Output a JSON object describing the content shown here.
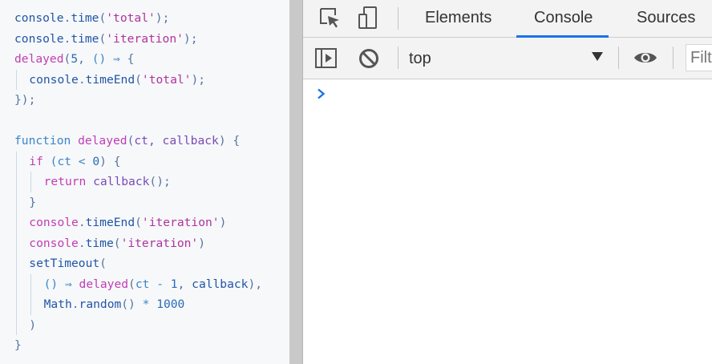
{
  "code": {
    "lines": [
      [
        {
          "t": "console",
          "c": "fn"
        },
        {
          "t": ".",
          "c": "punc"
        },
        {
          "t": "time",
          "c": "fn"
        },
        {
          "t": "(",
          "c": "punc"
        },
        {
          "t": "'total'",
          "c": "str"
        },
        {
          "t": ");",
          "c": "punc"
        }
      ],
      [
        {
          "t": "console",
          "c": "fn"
        },
        {
          "t": ".",
          "c": "punc"
        },
        {
          "t": "time",
          "c": "fn"
        },
        {
          "t": "(",
          "c": "punc"
        },
        {
          "t": "'iteration'",
          "c": "str"
        },
        {
          "t": ");",
          "c": "punc"
        }
      ],
      [
        {
          "t": "delayed",
          "c": "kw"
        },
        {
          "t": "(",
          "c": "punc"
        },
        {
          "t": "5",
          "c": "num"
        },
        {
          "t": ", ",
          "c": "punc"
        },
        {
          "t": "() ⇒ ",
          "c": "op"
        },
        {
          "t": "{",
          "c": "punc"
        }
      ],
      [
        {
          "t": "console",
          "c": "fn"
        },
        {
          "t": ".",
          "c": "punc"
        },
        {
          "t": "timeEnd",
          "c": "fn"
        },
        {
          "t": "(",
          "c": "punc"
        },
        {
          "t": "'total'",
          "c": "str"
        },
        {
          "t": ");",
          "c": "punc"
        }
      ],
      [
        {
          "t": "});",
          "c": "punc"
        }
      ],
      [],
      [
        {
          "t": "function ",
          "c": "op"
        },
        {
          "t": "delayed",
          "c": "kw"
        },
        {
          "t": "(",
          "c": "punc"
        },
        {
          "t": "ct, callback",
          "c": "ident"
        },
        {
          "t": ") {",
          "c": "punc"
        }
      ],
      [
        {
          "t": "if ",
          "c": "kw"
        },
        {
          "t": "(ct < ",
          "c": "op"
        },
        {
          "t": "0",
          "c": "num"
        },
        {
          "t": ") {",
          "c": "punc"
        }
      ],
      [
        {
          "t": "return ",
          "c": "kw"
        },
        {
          "t": "callback",
          "c": "ident"
        },
        {
          "t": "();",
          "c": "punc"
        }
      ],
      [
        {
          "t": "}",
          "c": "punc"
        }
      ],
      [
        {
          "t": "console",
          "c": "kw"
        },
        {
          "t": ".",
          "c": "punc"
        },
        {
          "t": "timeEnd",
          "c": "fn"
        },
        {
          "t": "(",
          "c": "punc"
        },
        {
          "t": "'iteration'",
          "c": "str"
        },
        {
          "t": ")",
          "c": "punc"
        }
      ],
      [
        {
          "t": "console",
          "c": "kw"
        },
        {
          "t": ".",
          "c": "punc"
        },
        {
          "t": "time",
          "c": "fn"
        },
        {
          "t": "(",
          "c": "punc"
        },
        {
          "t": "'iteration'",
          "c": "str"
        },
        {
          "t": ")",
          "c": "punc"
        }
      ],
      [
        {
          "t": "setTimeout",
          "c": "fn"
        },
        {
          "t": "(",
          "c": "punc"
        }
      ],
      [
        {
          "t": "() ⇒ ",
          "c": "op"
        },
        {
          "t": "delayed",
          "c": "kw"
        },
        {
          "t": "(",
          "c": "punc"
        },
        {
          "t": "ct - ",
          "c": "op"
        },
        {
          "t": "1",
          "c": "num"
        },
        {
          "t": ", ",
          "c": "punc"
        },
        {
          "t": "callback",
          "c": "fn"
        },
        {
          "t": "),",
          "c": "punc"
        }
      ],
      [
        {
          "t": "Math",
          "c": "fn"
        },
        {
          "t": ".",
          "c": "punc"
        },
        {
          "t": "random",
          "c": "fn"
        },
        {
          "t": "() ",
          "c": "punc"
        },
        {
          "t": "* ",
          "c": "op"
        },
        {
          "t": "1000",
          "c": "num"
        }
      ],
      [
        {
          "t": ")",
          "c": "punc"
        }
      ],
      [
        {
          "t": "}",
          "c": "punc"
        }
      ]
    ],
    "indents": [
      0,
      0,
      0,
      1,
      0,
      0,
      0,
      1,
      2,
      1,
      1,
      1,
      1,
      2,
      2,
      1,
      0
    ]
  },
  "devtools": {
    "tabs": [
      {
        "label": "Elements",
        "active": false
      },
      {
        "label": "Console",
        "active": true
      },
      {
        "label": "Sources",
        "active": false
      }
    ],
    "context_value": "top",
    "filter_placeholder": "Filter",
    "accent_color": "#1a73e8",
    "icons": {
      "inspect": "inspect-element-icon",
      "device": "device-toolbar-icon",
      "sidebar": "console-sidebar-icon",
      "clear": "clear-console-icon",
      "eye": "live-expression-eye-icon",
      "prompt": "console-prompt-chevron-icon"
    }
  }
}
